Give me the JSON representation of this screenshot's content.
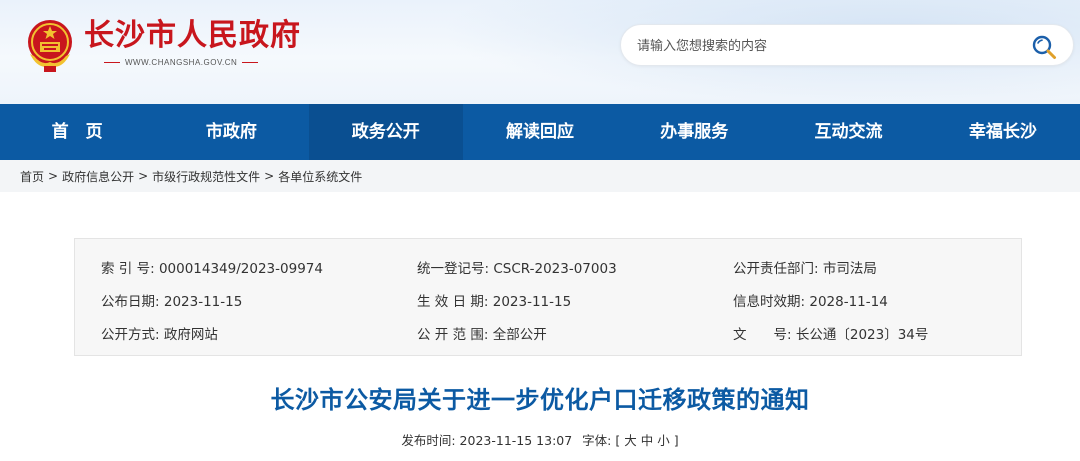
{
  "header": {
    "site_title": "长沙市人民政府",
    "site_domain": "WWW.CHANGSHA.GOV.CN",
    "search_placeholder": "请输入您想搜索的内容"
  },
  "nav": {
    "items": [
      {
        "label": "首　页",
        "active": false
      },
      {
        "label": "市政府",
        "active": false
      },
      {
        "label": "政务公开",
        "active": true
      },
      {
        "label": "解读回应",
        "active": false
      },
      {
        "label": "办事服务",
        "active": false
      },
      {
        "label": "互动交流",
        "active": false
      },
      {
        "label": "幸福长沙",
        "active": false
      }
    ]
  },
  "breadcrumb": {
    "items": [
      "首页",
      "政府信息公开",
      "市级行政规范性文件",
      "各单位系统文件"
    ],
    "separator": ">"
  },
  "info": {
    "index_label": "索 引 号:",
    "index_value": "000014349/2023-09974",
    "reg_label": "统一登记号:",
    "reg_value": "CSCR-2023-07003",
    "dept_label": "公开责任部门:",
    "dept_value": "市司法局",
    "pubdate_label": "公布日期:",
    "pubdate_value": "2023-11-15",
    "effdate_label": "生 效 日 期:",
    "effdate_value": "2023-11-15",
    "expdate_label": "信息时效期:",
    "expdate_value": "2028-11-14",
    "method_label": "公开方式:",
    "method_value": "政府网站",
    "scope_label": "公 开 范 围:",
    "scope_value": "全部公开",
    "docno_label": "文　　号:",
    "docno_value": "长公通〔2023〕34号"
  },
  "document": {
    "title": "长沙市公安局关于进一步优化户口迁移政策的通知",
    "publish_label": "发布时间:",
    "publish_time": "2023-11-15 13:07",
    "font_label": "字体:",
    "font_open": "[",
    "font_large": "大",
    "font_medium": "中",
    "font_small": "小",
    "font_close": "]"
  },
  "colors": {
    "brand_red": "#c8161d",
    "nav_blue": "#0c5aa3",
    "title_blue": "#0c5aa3"
  },
  "icons": {
    "emblem": "national-emblem-icon",
    "search": "search-icon"
  }
}
